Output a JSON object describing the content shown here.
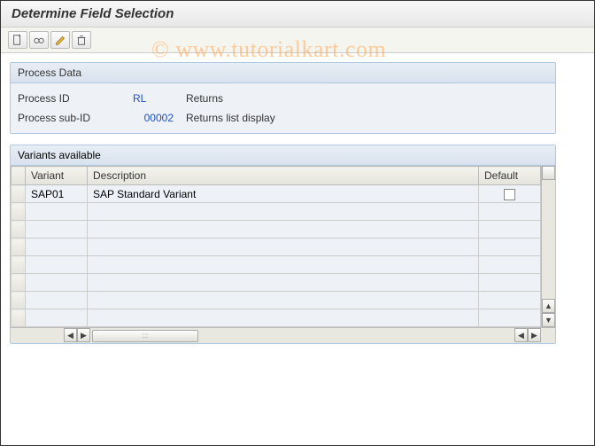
{
  "title": "Determine Field Selection",
  "watermark": "© www.tutorialkart.com",
  "toolbar": {
    "new": "new-document",
    "display": "glasses",
    "edit": "pencil",
    "delete": "trash"
  },
  "processPanel": {
    "header": "Process Data",
    "rows": [
      {
        "label": "Process ID",
        "value": "RL",
        "desc": "Returns"
      },
      {
        "label": "Process sub-ID",
        "value": "00002",
        "desc": "Returns list display"
      }
    ]
  },
  "variantsPanel": {
    "header": "Variants available",
    "columns": {
      "variant": "Variant",
      "description": "Description",
      "default": "Default"
    },
    "rows": [
      {
        "variant": "SAP01",
        "description": "SAP Standard Variant",
        "default": false
      }
    ],
    "emptyRows": 7
  }
}
